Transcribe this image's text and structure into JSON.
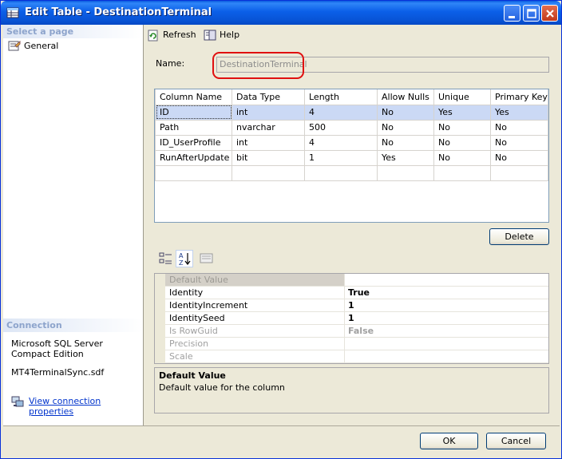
{
  "window": {
    "title": "Edit Table - DestinationTerminal"
  },
  "left_pane": {
    "select_page_header": "Select a page",
    "pages": [
      {
        "label": "General"
      }
    ],
    "connection_header": "Connection",
    "server_text": "Microsoft SQL Server Compact Edition",
    "database_file": "MT4TerminalSync.sdf",
    "view_connection_link": "View connection properties"
  },
  "toolbar": {
    "refresh_label": "Refresh",
    "help_label": "Help"
  },
  "form": {
    "name_label": "Name:",
    "name_value": "DestinationTerminal"
  },
  "columns_grid": {
    "headers": [
      "Column Name",
      "Data Type",
      "Length",
      "Allow Nulls",
      "Unique",
      "Primary Key"
    ],
    "rows": [
      [
        "ID",
        "int",
        "4",
        "No",
        "Yes",
        "Yes"
      ],
      [
        "Path",
        "nvarchar",
        "500",
        "No",
        "No",
        "No"
      ],
      [
        "ID_UserProfile",
        "int",
        "4",
        "No",
        "No",
        "No"
      ],
      [
        "RunAfterUpdate",
        "bit",
        "1",
        "Yes",
        "No",
        "No"
      ]
    ],
    "selected_row": 0
  },
  "buttons": {
    "delete": "Delete",
    "ok": "OK",
    "cancel": "Cancel"
  },
  "properties": {
    "rows": [
      {
        "name": "Default Value",
        "value": ""
      },
      {
        "name": "Identity",
        "value": "True"
      },
      {
        "name": "IdentityIncrement",
        "value": "1"
      },
      {
        "name": "IdentitySeed",
        "value": "1"
      },
      {
        "name": "Is RowGuid",
        "value": "False"
      },
      {
        "name": "Precision",
        "value": ""
      },
      {
        "name": "Scale",
        "value": ""
      }
    ],
    "description_title": "Default Value",
    "description_text": "Default value for the column"
  },
  "colors": {
    "title_bar": "#0a5bdf",
    "window_face": "#ece9d8",
    "selection": "#cbd9f5",
    "highlight_oval": "#e01010",
    "link": "#0033cc"
  }
}
